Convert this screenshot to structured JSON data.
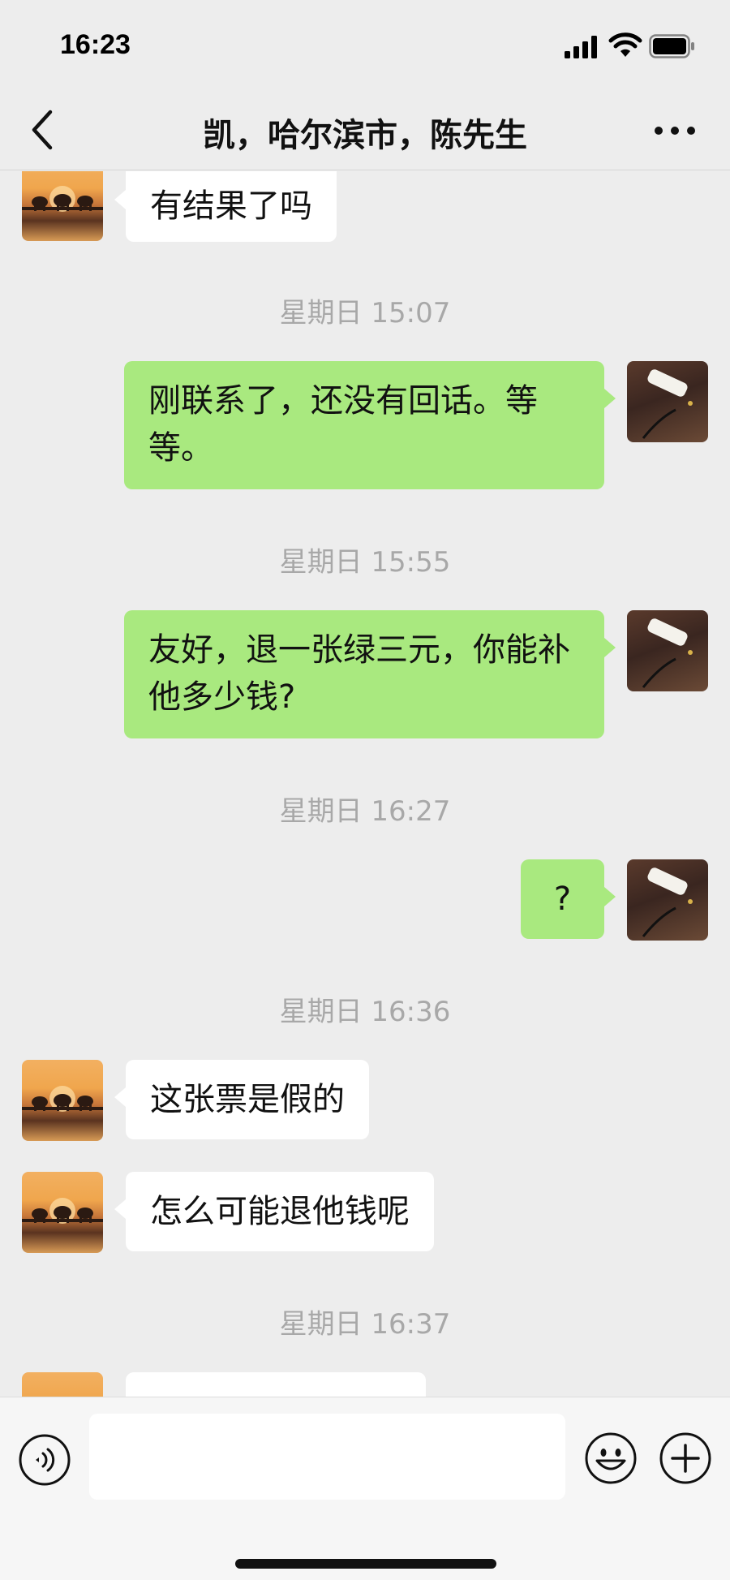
{
  "status_bar": {
    "time": "16:23"
  },
  "nav": {
    "title": "凯，哈尔滨市，陈先生"
  },
  "messages": [
    {
      "type": "message",
      "side": "left",
      "text": "有结果了吗"
    },
    {
      "type": "timestamp",
      "text": "星期日 15:07"
    },
    {
      "type": "message",
      "side": "right",
      "text": "刚联系了，还没有回话。等等。"
    },
    {
      "type": "timestamp",
      "text": "星期日 15:55"
    },
    {
      "type": "message",
      "side": "right",
      "text": "友好，退一张绿三元，你能补他多少钱?"
    },
    {
      "type": "timestamp",
      "text": "星期日 16:27"
    },
    {
      "type": "message",
      "side": "right",
      "text": "?"
    },
    {
      "type": "timestamp",
      "text": "星期日 16:36"
    },
    {
      "type": "message",
      "side": "left",
      "text": "这张票是假的"
    },
    {
      "type": "message",
      "side": "left",
      "text": "怎么可能退他钱呢"
    },
    {
      "type": "timestamp",
      "text": "星期日 16:37"
    }
  ],
  "input": {
    "value": ""
  },
  "colors": {
    "background": "#ededed",
    "sent_bubble": "#a9e97f",
    "received_bubble": "#ffffff",
    "timestamp": "#a8a8a8"
  },
  "icons": [
    "back-icon",
    "more-icon",
    "signal-icon",
    "wifi-icon",
    "battery-icon",
    "voice-icon",
    "emoji-icon",
    "plus-icon"
  ]
}
